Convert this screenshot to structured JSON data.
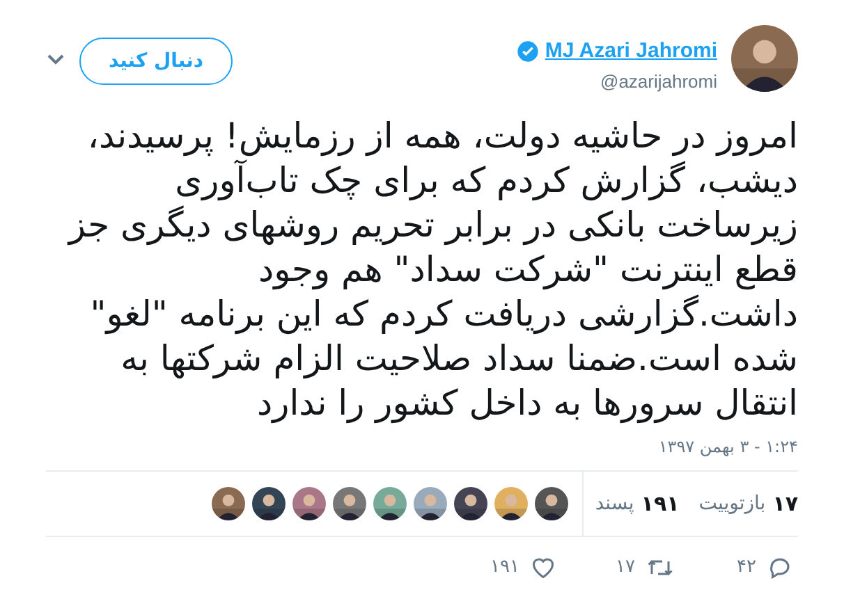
{
  "author": {
    "name": "MJ Azari Jahromi",
    "handle": "@azarijahromi",
    "verified": true
  },
  "follow_button": {
    "label": "دنبال کنید"
  },
  "tweet_text": "امروز در حاشیه دولت، همه از رزمایش! پرسیدند، دیشب، گزارش کردم که برای چک تاب‌آوری زیرساخت بانکی در برابر تحریم روشهای دیگری جز قطع اینترنت \"شرکت سداد\" هم وجود داشت.گزارشی دریافت کردم که این برنامه \"لغو\" شده است.ضمنا سداد صلاحیت الزام شرکتها به انتقال سرورها به داخل کشور را ندارد",
  "timestamp": "۱:۲۴ - ۳ بهمن ۱۳۹۷",
  "stats": [
    {
      "count": "۱۷",
      "label": "بازتوییت"
    },
    {
      "count": "۱۹۱",
      "label": "پسند"
    }
  ],
  "actions": [
    {
      "kind": "reply",
      "count": "۴۲"
    },
    {
      "kind": "retweet",
      "count": "۱۷"
    },
    {
      "kind": "like",
      "count": "۱۹۱"
    }
  ]
}
